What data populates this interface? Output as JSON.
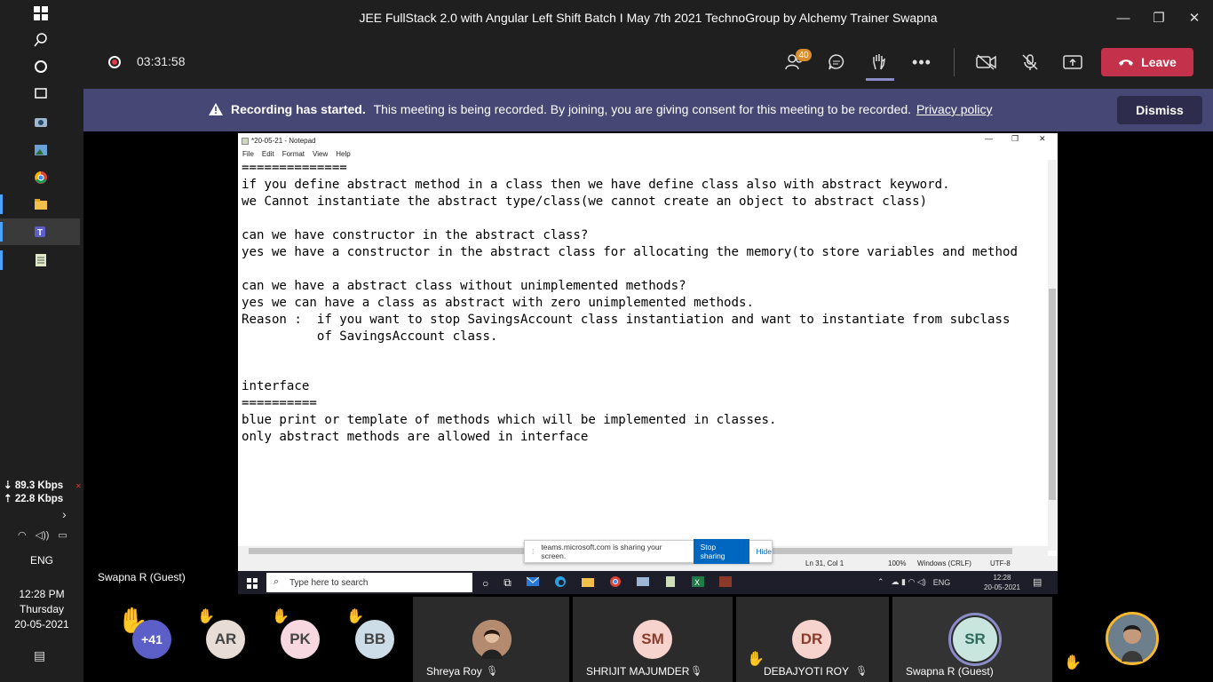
{
  "window": {
    "title": "JEE FullStack 2.0 with Angular Left Shift Batch I May 7th 2021 TechnoGroup by Alchemy Trainer Swapna",
    "minimize": "—",
    "maximize": "❐",
    "close": "✕"
  },
  "meeting": {
    "timer": "03:31:58",
    "participants_count": "40",
    "leave_label": "Leave"
  },
  "banner": {
    "bold": "Recording has started.",
    "text": "This meeting is being recorded. By joining, you are giving consent for this meeting to be recorded.",
    "link": "Privacy policy",
    "dismiss": "Dismiss"
  },
  "notepad": {
    "title": "*20-05-21 - Notepad",
    "menu": [
      "File",
      "Edit",
      "Format",
      "View",
      "Help"
    ],
    "content": "==============\nif you define abstract method in a class then we have define class also with abstract keyword.\nwe Cannot instantiate the abstract type/class(we cannot create an object to abstract class)\n\ncan we have constructor in the abstract class?\nyes we have a constructor in the abstract class for allocating the memory(to store variables and method\n\ncan we have a abstract class without unimplemented methods?\nyes we can have a class as abstract with zero unimplemented methods.\nReason :  if you want to stop SavingsAccount class instantiation and want to instantiate from subclass\n          of SavingsAccount class.\n\n\ninterface\n==========\nblue print or template of methods which will be implemented in classes.\nonly abstract methods are allowed in interface",
    "status": {
      "position": "Ln 31, Col 1",
      "zoom": "100%",
      "eol": "Windows (CRLF)",
      "encoding": "UTF-8"
    }
  },
  "sharing_popup": {
    "text": "teams.microsoft.com is sharing your screen.",
    "stop": "Stop sharing",
    "hide": "Hide"
  },
  "remote_taskbar": {
    "search_placeholder": "Type here to search",
    "lang": "ENG",
    "time": "12:28",
    "date": "20-05-2021"
  },
  "local_taskbar": {
    "download": "⇣ 89.3 Kbps",
    "upload": "⇡ 22.8 Kbps",
    "lang": "ENG",
    "time": "12:28 PM",
    "day": "Thursday",
    "date": "20-05-2021"
  },
  "presenter_label": "Swapna R (Guest)",
  "gallery": {
    "overflow": "+41",
    "small": [
      "AR",
      "PK",
      "BB"
    ],
    "tiles": [
      {
        "name": "Shreya Roy",
        "initials": ""
      },
      {
        "name": "SHRIJIT MAJUMDER",
        "initials": "SM"
      },
      {
        "name": "DEBAJYOTI ROY",
        "initials": "DR"
      },
      {
        "name": "Swapna R (Guest)",
        "initials": "SR"
      }
    ]
  },
  "colors": {
    "accent": "#464775",
    "leave": "#c4314b",
    "recording": "#e53a47"
  }
}
